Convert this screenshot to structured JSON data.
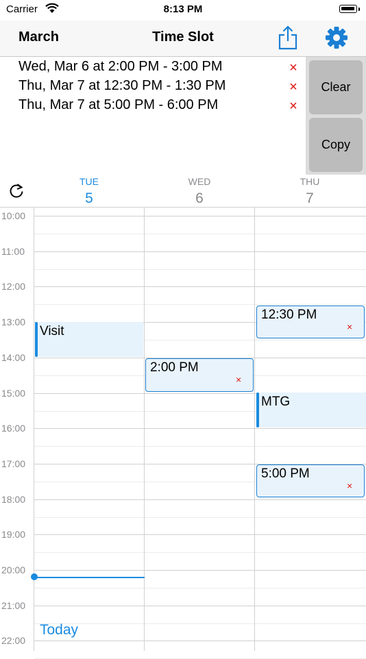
{
  "status_bar": {
    "carrier": "Carrier",
    "time": "8:13 PM"
  },
  "nav": {
    "month": "March",
    "title": "Time Slot"
  },
  "selected_slots": [
    {
      "label": "Wed, Mar 6 at 2:00 PM - 3:00 PM"
    },
    {
      "label": "Thu, Mar 7 at 12:30 PM - 1:30 PM"
    },
    {
      "label": "Thu, Mar 7 at 5:00 PM - 6:00 PM"
    }
  ],
  "buttons": {
    "clear": "Clear",
    "copy": "Copy",
    "today": "Today"
  },
  "days": [
    {
      "name": "TUE",
      "num": "5",
      "is_today": true
    },
    {
      "name": "WED",
      "num": "6",
      "is_today": false
    },
    {
      "name": "THU",
      "num": "7",
      "is_today": false
    }
  ],
  "hours": [
    "10:00",
    "11:00",
    "12:00",
    "13:00",
    "14:00",
    "15:00",
    "16:00",
    "17:00",
    "18:00",
    "19:00",
    "20:00",
    "21:00",
    "22:00"
  ],
  "events": {
    "visit": "Visit",
    "wed_slot": "2:00 PM",
    "thu_slot1": "12:30 PM",
    "mtg": "MTG",
    "thu_slot2": "5:00 PM",
    "remove_glyph": "×"
  },
  "colors": {
    "accent": "#1a8be0",
    "remove": "#e01010"
  }
}
